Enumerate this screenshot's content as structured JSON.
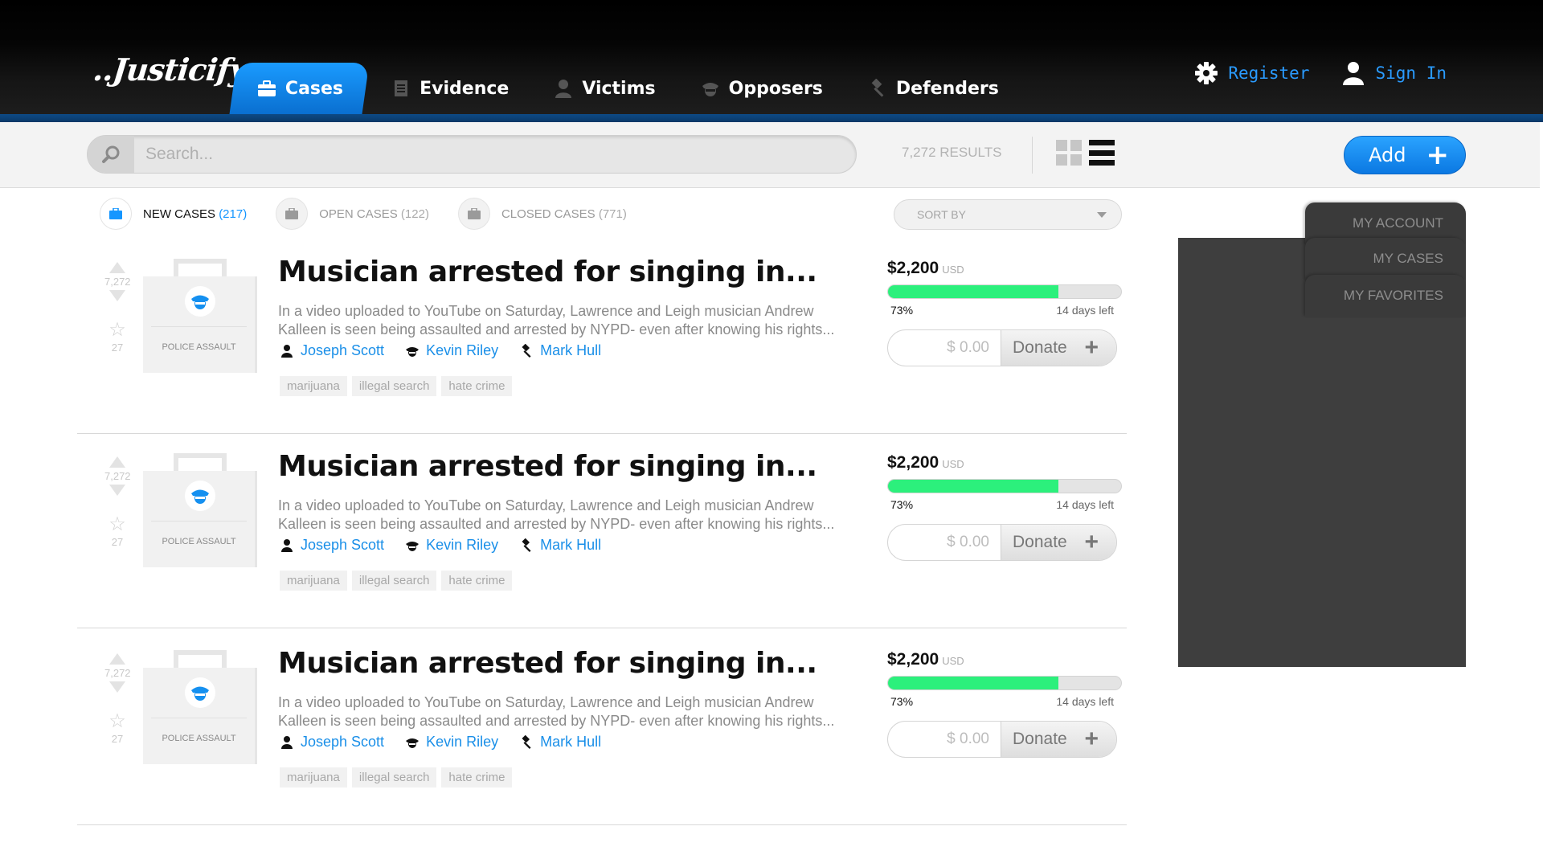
{
  "app": {
    "logo": "..Justicify.."
  },
  "nav": [
    {
      "label": "Cases",
      "icon": "briefcase-icon",
      "active": true
    },
    {
      "label": "Evidence",
      "icon": "document-icon",
      "active": false
    },
    {
      "label": "Victims",
      "icon": "person-icon",
      "active": false
    },
    {
      "label": "Opposers",
      "icon": "police-icon",
      "active": false
    },
    {
      "label": "Defenders",
      "icon": "gavel-icon",
      "active": false
    }
  ],
  "header_right": {
    "register": "Register",
    "sign_in": "Sign In"
  },
  "search": {
    "placeholder": "Search...",
    "results": "7,272 RESULTS",
    "add_label": "Add"
  },
  "filters": [
    {
      "label": "NEW CASES",
      "count": "(217)",
      "active": true
    },
    {
      "label": "OPEN CASES",
      "count": "(122)",
      "active": false
    },
    {
      "label": "CLOSED CASES",
      "count": "(771)",
      "active": false
    }
  ],
  "sort": {
    "label": "SORT BY"
  },
  "cases": [
    {
      "votes": "7,272",
      "favorites": "27",
      "category": "POLICE ASSAULT",
      "title": "Musician arrested for singing in...",
      "description": "In a video uploaded to YouTube on Saturday, Lawrence and Leigh musician Andrew Kalleen is seen being assaulted and arrested by NYPD- even after knowing his rights...",
      "victim": "Joseph Scott",
      "opposer": "Kevin Riley",
      "defender": "Mark Hull",
      "tags": [
        "marijuana",
        "illegal search",
        "hate crime"
      ],
      "amount": "$2,200",
      "currency": "USD",
      "progress": 0.73,
      "percent": "73%",
      "days_left": "14 days left",
      "donate_placeholder": "$ 0.00",
      "donate_label": "Donate"
    },
    {
      "votes": "7,272",
      "favorites": "27",
      "category": "POLICE ASSAULT",
      "title": "Musician arrested for singing in...",
      "description": "In a video uploaded to YouTube on Saturday, Lawrence and Leigh musician Andrew Kalleen is seen being assaulted and arrested by NYPD- even after knowing his rights...",
      "victim": "Joseph Scott",
      "opposer": "Kevin Riley",
      "defender": "Mark Hull",
      "tags": [
        "marijuana",
        "illegal search",
        "hate crime"
      ],
      "amount": "$2,200",
      "currency": "USD",
      "progress": 0.73,
      "percent": "73%",
      "days_left": "14 days left",
      "donate_placeholder": "$ 0.00",
      "donate_label": "Donate"
    },
    {
      "votes": "7,272",
      "favorites": "27",
      "category": "POLICE ASSAULT",
      "title": "Musician arrested for singing in...",
      "description": "In a video uploaded to YouTube on Saturday, Lawrence and Leigh musician Andrew Kalleen is seen being assaulted and arrested by NYPD- even after knowing his rights...",
      "victim": "Joseph Scott",
      "opposer": "Kevin Riley",
      "defender": "Mark Hull",
      "tags": [
        "marijuana",
        "illegal search",
        "hate crime"
      ],
      "amount": "$2,200",
      "currency": "USD",
      "progress": 0.73,
      "percent": "73%",
      "days_left": "14 days left",
      "donate_placeholder": "$ 0.00",
      "donate_label": "Donate"
    }
  ],
  "account_panel": {
    "tabs": [
      "MY ACCOUNT",
      "MY CASES",
      "MY FAVORITES"
    ]
  },
  "colors": {
    "accent": "#1596ff",
    "progress": "#2cf07c",
    "panel": "#3e3e3e"
  }
}
